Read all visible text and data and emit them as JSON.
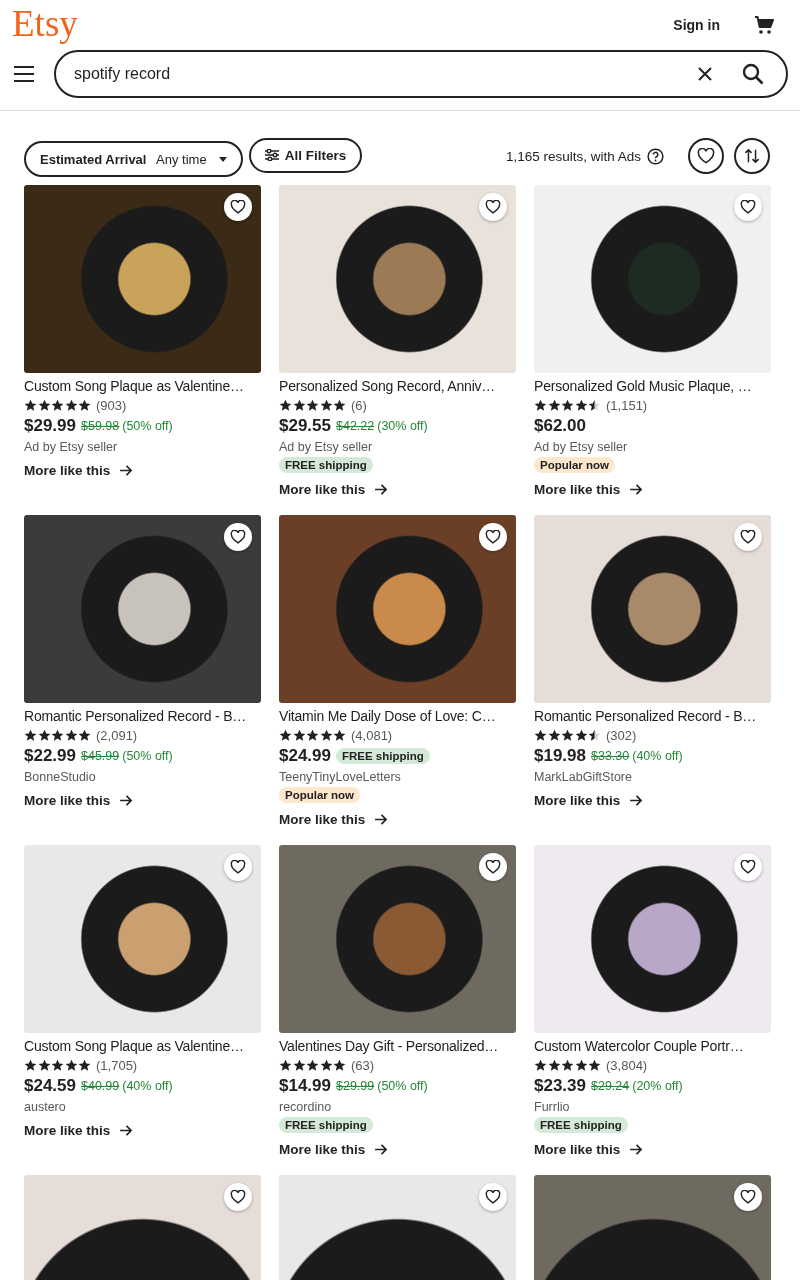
{
  "header": {
    "logo": "Etsy",
    "sign_in": "Sign in"
  },
  "search": {
    "value": "spotify record"
  },
  "filters": {
    "arrival_label": "Estimated Arrival",
    "arrival_value": "Any time",
    "all_filters": "All Filters",
    "results": "1,165 results, with Ads"
  },
  "listings": [
    {
      "title": "Custom Song Plaque as Valentine…",
      "stars": 5,
      "reviews": "(903)",
      "price": "$29.99",
      "original_price": "$59.98",
      "discount": "(50% off)",
      "seller": "Ad by Etsy seller",
      "favorited": false,
      "more": "More like this"
    },
    {
      "title": "Personalized Song Record, Anniv…",
      "stars": 5,
      "reviews": "(6)",
      "price": "$29.55",
      "original_price": "$42.22",
      "discount": "(30% off)",
      "seller": "Ad by Etsy seller",
      "favorited": false,
      "badges": [
        {
          "kind": "shipping",
          "text": "FREE shipping"
        }
      ],
      "more": "More like this"
    },
    {
      "title": "Personalized Gold Music Plaque, …",
      "stars": 4.5,
      "reviews": "(1,151)",
      "price": "$62.00",
      "seller": "Ad by Etsy seller",
      "favorited": false,
      "badges": [
        {
          "kind": "popular",
          "text": "Popular now"
        }
      ],
      "more": "More like this"
    },
    {
      "title": "Romantic Personalized Record - B…",
      "stars": 5,
      "reviews": "(2,091)",
      "price": "$22.99",
      "original_price": "$45.99",
      "discount": "(50% off)",
      "seller": "BonneStudio",
      "favorited": false,
      "more": "More like this"
    },
    {
      "title": "Vitamin Me Daily Dose of Love: C…",
      "stars": 5,
      "reviews": "(4,081)",
      "price": "$24.99",
      "price_badge": {
        "kind": "shipping",
        "text": "FREE shipping"
      },
      "seller": "TeenyTinyLoveLetters",
      "favorited": false,
      "badges": [
        {
          "kind": "popular",
          "text": "Popular now"
        }
      ],
      "more": "More like this"
    },
    {
      "title": "Romantic Personalized Record - B…",
      "stars": 4.5,
      "reviews": "(302)",
      "price": "$19.98",
      "original_price": "$33.30",
      "discount": "(40% off)",
      "seller": "MarkLabGiftStore",
      "favorited": false,
      "more": "More like this"
    },
    {
      "title": "Custom Song Plaque as Valentine…",
      "stars": 5,
      "reviews": "(1,705)",
      "price": "$24.59",
      "original_price": "$40.99",
      "discount": "(40% off)",
      "seller": "austero",
      "favorited": false,
      "more": "More like this"
    },
    {
      "title": "Valentines Day Gift - Personalized…",
      "stars": 5,
      "reviews": "(63)",
      "price": "$14.99",
      "original_price": "$29.99",
      "discount": "(50% off)",
      "seller": "recordino",
      "favorited": false,
      "badges": [
        {
          "kind": "shipping",
          "text": "FREE shipping"
        }
      ],
      "more": "More like this"
    },
    {
      "title": "Custom Watercolor Couple Portr…",
      "stars": 5,
      "reviews": "(3,804)",
      "price": "$23.39",
      "original_price": "$29.24",
      "discount": "(20% off)",
      "seller": "Furrlio",
      "favorited": false,
      "badges": [
        {
          "kind": "shipping",
          "text": "FREE shipping"
        }
      ],
      "more": "More like this"
    }
  ],
  "more_listings": [
    {
      "favorited": false
    },
    {
      "favorited": false
    },
    {
      "favorited": false
    }
  ]
}
